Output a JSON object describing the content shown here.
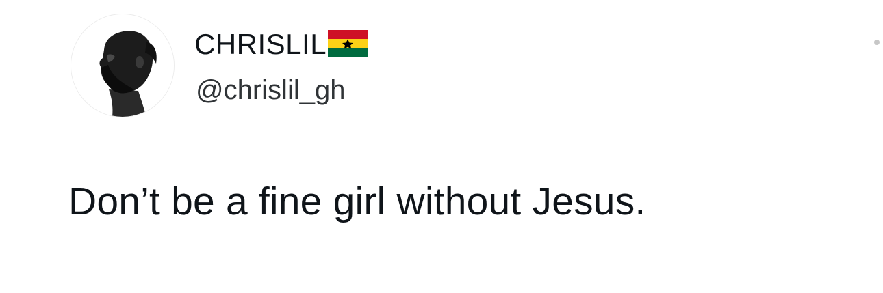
{
  "tweet": {
    "author": {
      "display_name": "CHRISLIL",
      "flag_icon": "ghana-flag-icon",
      "handle": "@chrislil_gh",
      "avatar_icon": "profile-silhouette-avatar"
    },
    "text": "Don’t be a fine girl without Jesus.",
    "menu_icon": "more-options-icon"
  },
  "colors": {
    "flag_red": "#ce1126",
    "flag_gold": "#fcd116",
    "flag_green": "#006b3f",
    "flag_star": "#000000",
    "text": "#0f1419"
  }
}
